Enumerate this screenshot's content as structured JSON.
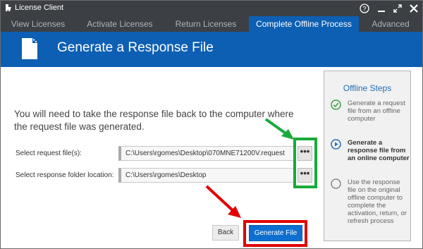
{
  "window": {
    "title": "License Client",
    "help_icon": "help-icon",
    "minimize_icon": "minimize-icon",
    "maximize_icon": "maximize-icon",
    "close_icon": "close-icon"
  },
  "tabs": [
    {
      "label": "View Licenses",
      "active": false
    },
    {
      "label": "Activate Licenses",
      "active": false
    },
    {
      "label": "Return Licenses",
      "active": false
    },
    {
      "label": "Complete Offline Process",
      "active": true
    },
    {
      "label": "Advanced",
      "active": false
    }
  ],
  "banner": {
    "heading": "Generate a Response File",
    "icon": "document-icon"
  },
  "main": {
    "instructions": "You will need to take the response file back to the computer where the request file was generated.",
    "request_field": {
      "label": "Select request file(s):",
      "value": "C:\\Users\\rgomes\\Desktop\\070MNE71200V.request",
      "browse_label": "•••"
    },
    "response_field": {
      "label": "Select response folder location:",
      "value": "C:\\Users\\rgomes\\Desktop",
      "browse_label": "•••"
    },
    "back_label": "Back",
    "generate_label": "Generate File"
  },
  "steps": {
    "heading": "Offline Steps",
    "items": [
      {
        "text": "Generate a request file from an offline computer",
        "status": "done",
        "icon": "check-circle-icon"
      },
      {
        "text": "Generate a response file from an online computer",
        "status": "current",
        "icon": "play-circle-icon"
      },
      {
        "text": "Use the response file on the original offline computer to complete the activation, return, or refresh process",
        "status": "pending",
        "icon": "empty-circle-icon"
      }
    ]
  },
  "colors": {
    "accent_blue": "#0d5fb3",
    "titlebar": "#3c3f44",
    "annotation_green": "#1aaa3a",
    "annotation_red": "#e00000",
    "step_done_green": "#3aa13a"
  }
}
